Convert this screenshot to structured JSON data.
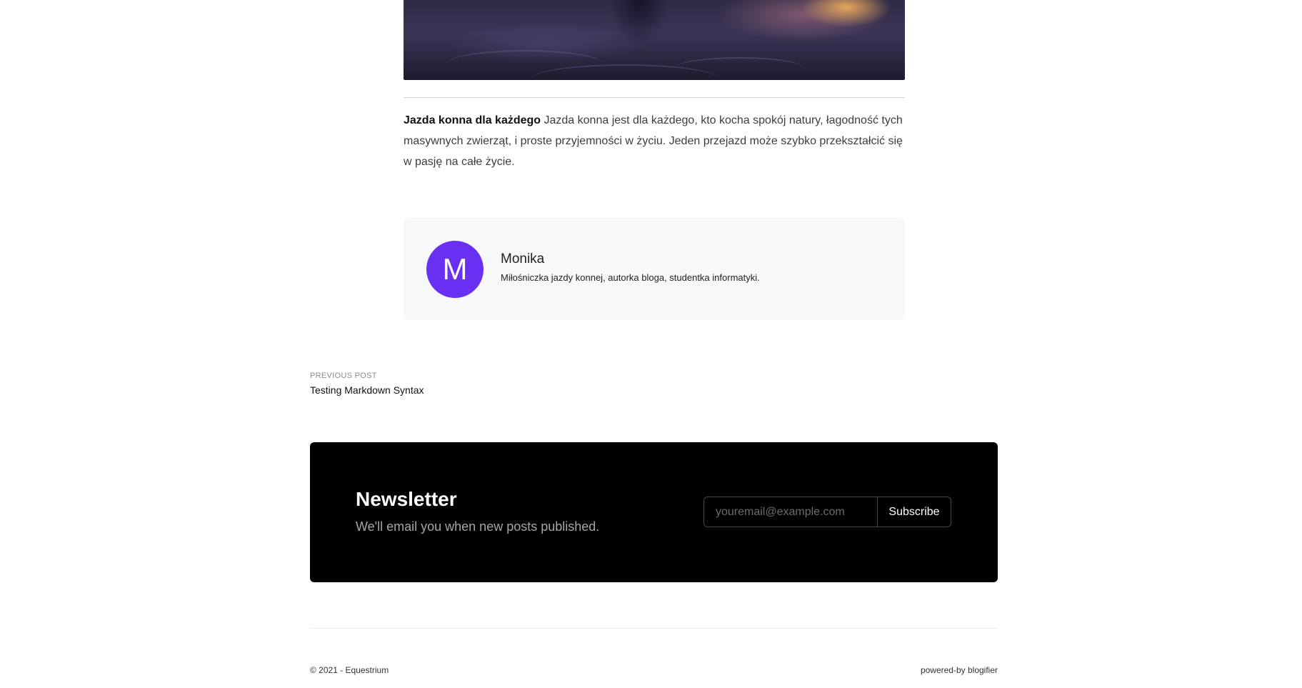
{
  "article": {
    "lead": "Jazda konna dla każdego",
    "body": " Jazda konna jest dla każdego, kto kocha spokój natury, łagodność tych masywnych zwierząt, i proste przyjemności w życiu. Jeden przejazd może szybko przekształcić się w pasję na całe życie."
  },
  "author": {
    "initial": "M",
    "name": "Monika",
    "bio": "Miłośniczka jazdy konnej, autorka bloga, studentka informatyki.",
    "avatar_color": "#6930f3"
  },
  "navigation": {
    "previous_label": "PREVIOUS POST",
    "previous_title": "Testing Markdown Syntax"
  },
  "newsletter": {
    "title": "Newsletter",
    "subtitle": "We'll email you when new posts published.",
    "placeholder": "youremail@example.com",
    "button_label": "Subscribe"
  },
  "footer": {
    "copyright": "© 2021 - Equestrium",
    "powered_by": "powered-by blogifier"
  }
}
